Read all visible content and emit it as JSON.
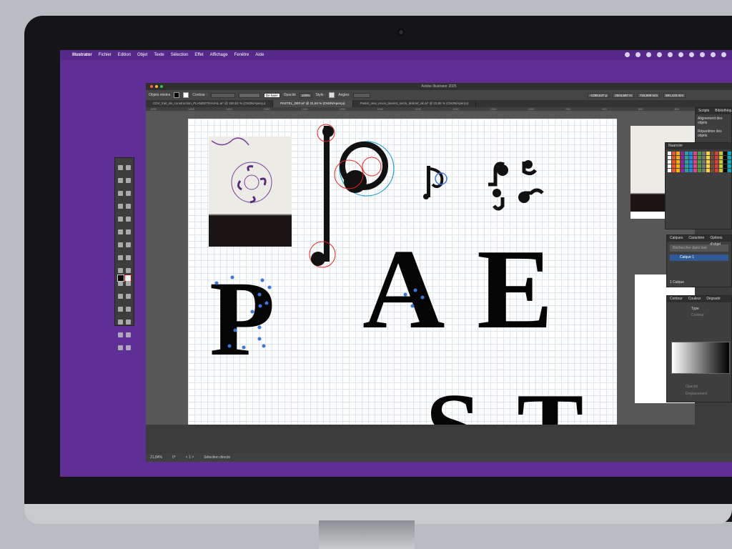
{
  "menubar": {
    "app_name": "Illustrator",
    "items": [
      "Fichier",
      "Edition",
      "Objet",
      "Texte",
      "Sélection",
      "Effet",
      "Affichage",
      "Fenêtre",
      "Aide"
    ]
  },
  "window": {
    "title": "Adobe Illustrator 2025",
    "control_bar": {
      "selection_label": "Objets mixtes",
      "stroke_label": "Contour :",
      "stroke_style": "De base",
      "opacity_label": "Opacité",
      "opacity_value": "100%",
      "style_label": "Style :",
      "angles_label": "Angles",
      "x_value": "-1399,537 p",
      "y_value": "2504,697 m",
      "w_value": "718,999 mm",
      "h_value": "581,433 mm"
    },
    "tabs": [
      "CDV_trait_de_construction_PLANDETRAVAIL.ai* @ 150,52 % (CMJN/Aperçu)",
      "PASTEL_DEF.ai* @ 21,84 % (CMJN/Aperçu)",
      "Pastel_new_envoi_laurent_seclo_debrief_ok.ai* @ 22,85 % (CMJN/Aperçu)"
    ],
    "active_tab_index": 1,
    "ruler_ticks": [
      "1500",
      "1450",
      "1400",
      "1350",
      "1300",
      "1250",
      "1200",
      "1150",
      "1100",
      "1050",
      "1000",
      "950",
      "900",
      "850",
      "800",
      "750",
      "700"
    ],
    "status": {
      "zoom": "21,84%",
      "rotation": "0°",
      "artboard_nav": "< 1 >",
      "tool": "Sélection directe"
    }
  },
  "artwork": {
    "letters": [
      "P",
      "A",
      "E",
      "S",
      "T"
    ]
  },
  "panels": {
    "right_tabs": [
      "Scripts",
      "Bibliothèques"
    ],
    "align_title": "Alignement des objets",
    "distribute_title": "Répartition des objets",
    "swatches_title": "Nuancier",
    "layers_tabs": [
      "Calques",
      "Caractère",
      "Options d'objet"
    ],
    "layers_search_placeholder": "Rechercher dans tout",
    "layer_name": "Calque 1",
    "layer_count": "1 Calque",
    "gradient_tabs": [
      "Contour",
      "Couleur",
      "Dégradé"
    ],
    "gradient_type_label": "Type",
    "gradient_stroke_label": "Contour",
    "gradient_opacity_label": "Opacité",
    "gradient_location_label": "Emplacement"
  }
}
